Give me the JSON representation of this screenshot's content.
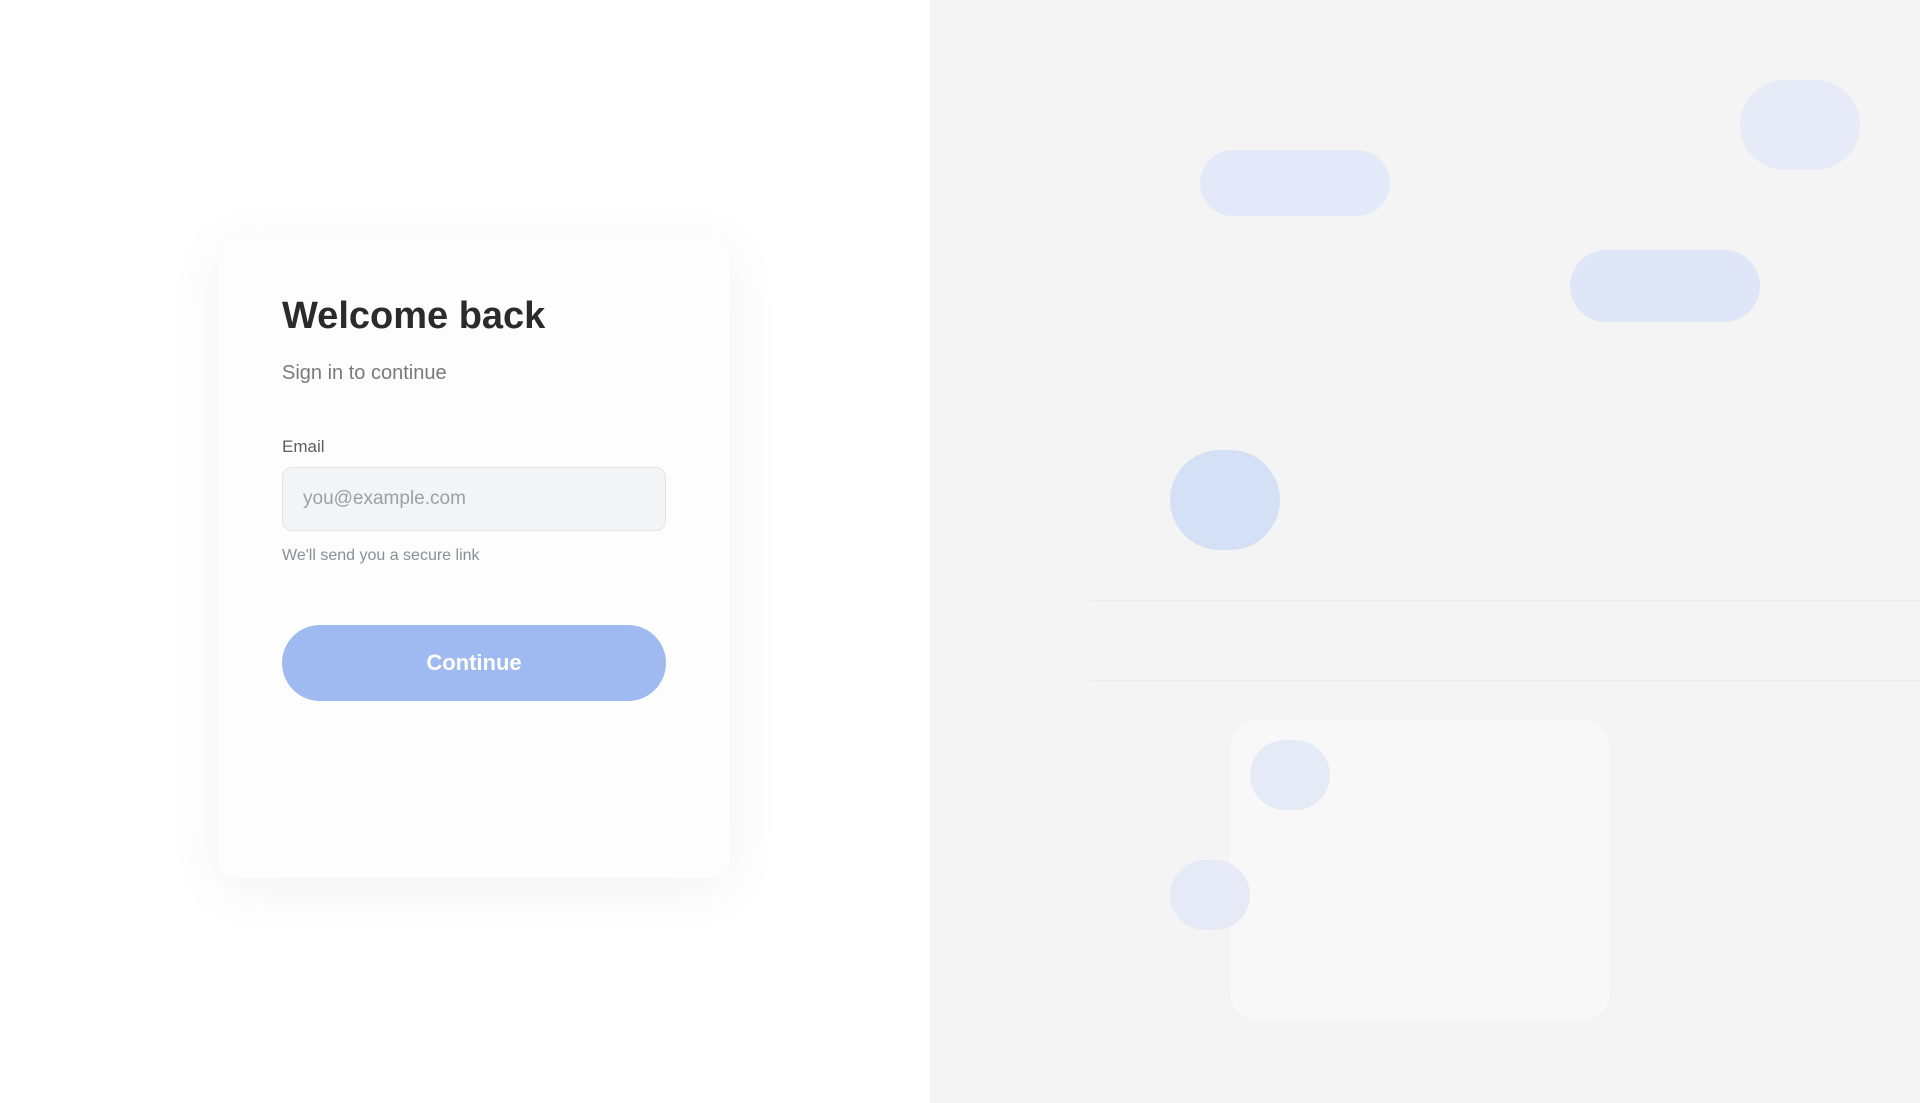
{
  "signin": {
    "title": "Welcome back",
    "subtitle": "Sign in to continue",
    "email_label": "Email",
    "email_placeholder": "you@example.com",
    "helper": "We'll send you a secure link",
    "continue_label": "Continue"
  },
  "colors": {
    "accent": "#9fbaf0",
    "panel_bg": "#f4f4f4"
  }
}
